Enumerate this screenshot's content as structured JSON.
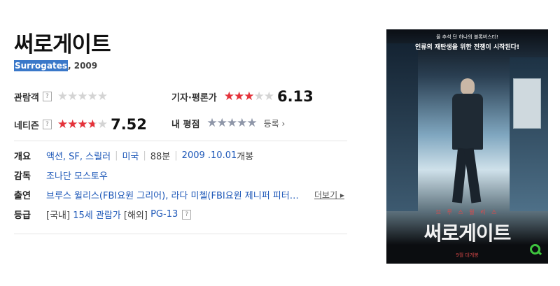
{
  "movie": {
    "title": "써로게이트",
    "original_title": "Surrogates",
    "year": ", 2009"
  },
  "ratings": {
    "audience": {
      "label": "관람객",
      "help": "?",
      "stars_filled": 0
    },
    "critics": {
      "label": "기자·평론가",
      "stars_filled": 3.0,
      "score": "6.13"
    },
    "netizen": {
      "label": "네티즌",
      "help": "?",
      "stars_filled": 3.76,
      "score": "7.52"
    },
    "my": {
      "label": "내 평점",
      "stars_filled": 0,
      "register_label": "등록 ›"
    }
  },
  "info": {
    "overview_label": "개요",
    "genres": "액션, SF, 스릴러",
    "country": "미국",
    "runtime": "88분",
    "release_date": "2009 .10.01",
    "release_suffix": " 개봉",
    "director_label": "감독",
    "director": "조나단 모스토우",
    "cast_label": "출연",
    "cast": "브루스 윌리스(FBI요원 그리어), 라다 미첼(FBI요원 제니퍼 피터…",
    "more_label": "더보기 ▸",
    "grade_label": "등급",
    "grade_domestic_prefix": "[국내]",
    "grade_domestic": "15세 관람가",
    "grade_foreign_prefix": "[해외]",
    "grade_foreign": "PG-13",
    "grade_help": "?"
  },
  "poster": {
    "tagline_small": "올 추석 단 하나의 블록버스터!",
    "tagline_main": "인류의 재탄생을 위한 전쟁이 시작된다!",
    "actor_name": "브 루 스  윌 리 스",
    "title_text": "써로게이트",
    "release_text": "9월 대개봉",
    "search_icon": "search-icon",
    "search_color": "#3ec43e"
  },
  "colors": {
    "star_red": "#e5323a",
    "star_gray": "#8e96a8",
    "link_blue": "#1e58b8",
    "highlight": "#3a78c9"
  }
}
